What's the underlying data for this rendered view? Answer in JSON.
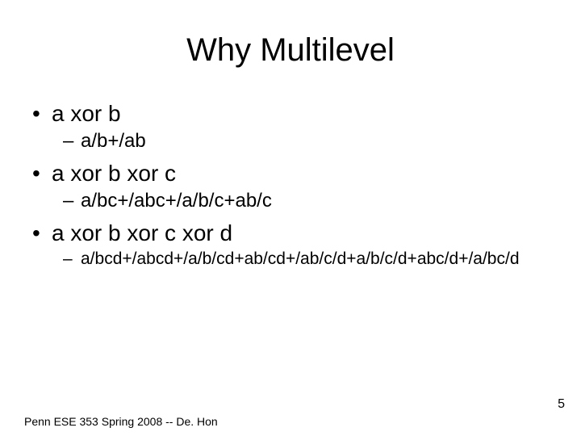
{
  "title": "Why Multilevel",
  "bullets": [
    {
      "level": 1,
      "text": "a xor b"
    },
    {
      "level": 2,
      "text": "a/b+/ab"
    },
    {
      "level": 1,
      "text": "a xor b xor c"
    },
    {
      "level": 2,
      "text": "a/bc+/abc+/a/b/c+ab/c"
    },
    {
      "level": 1,
      "text": "a xor b xor c xor d"
    },
    {
      "level": 2,
      "text": "a/bcd+/abcd+/a/b/cd+ab/cd+/ab/c/d+a/b/c/d+abc/d+/a/bc/d",
      "small": true
    }
  ],
  "footer": "Penn ESE 353 Spring 2008 -- De. Hon",
  "page_number": "5"
}
